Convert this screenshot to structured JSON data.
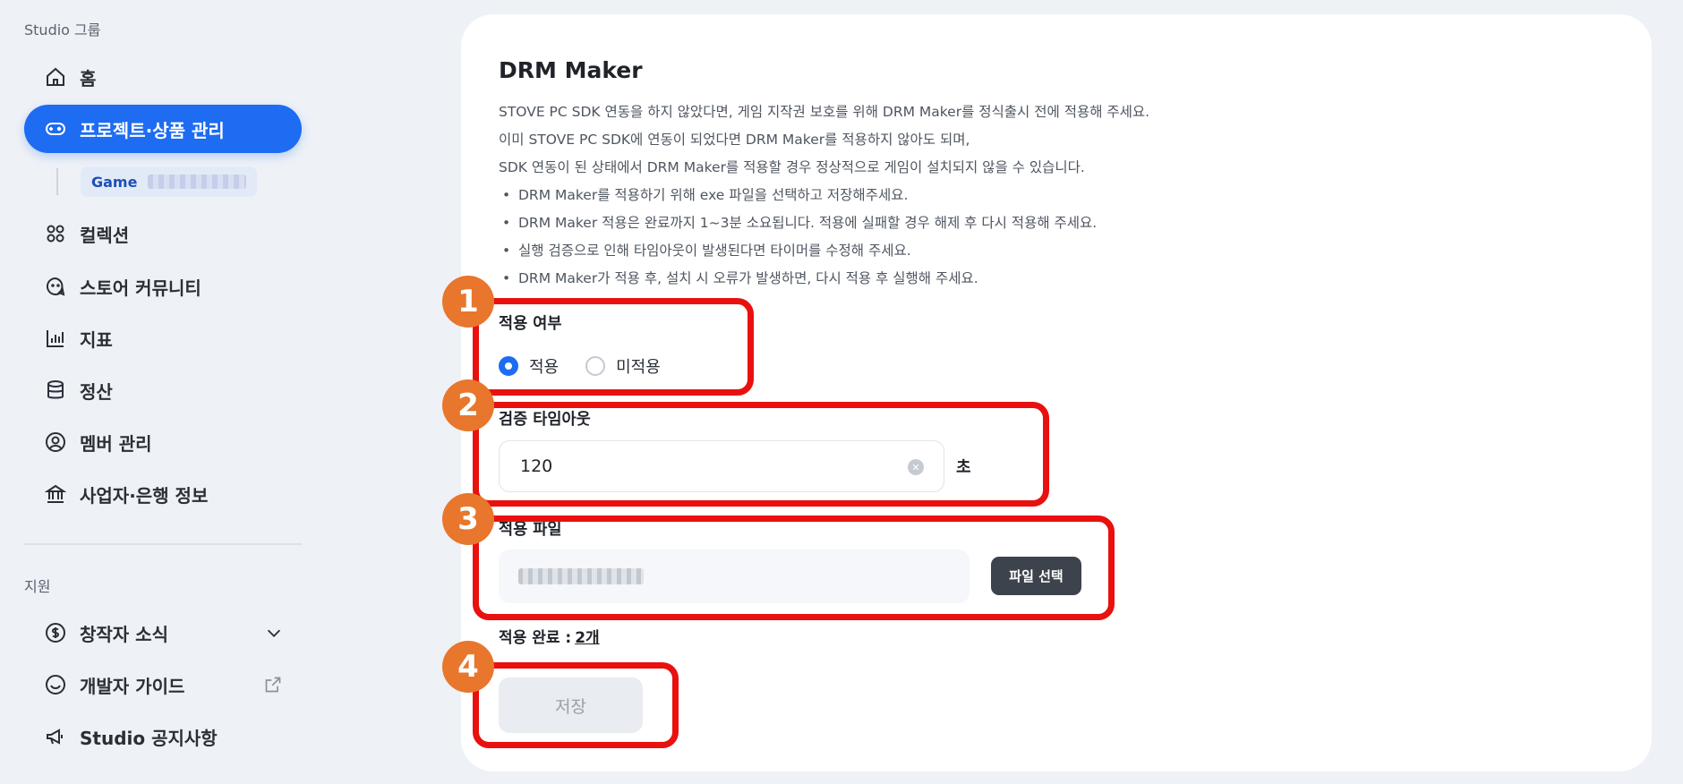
{
  "sidebar": {
    "group_label": "Studio 그룹",
    "items": [
      {
        "label": "홈",
        "icon": "home-icon"
      },
      {
        "label": "프로젝트·상품 관리",
        "icon": "gamepad-icon",
        "active": true
      },
      {
        "label": "컬렉션",
        "icon": "collection-icon"
      },
      {
        "label": "스토어 커뮤니티",
        "icon": "chat-icon"
      },
      {
        "label": "지표",
        "icon": "chart-icon"
      },
      {
        "label": "정산",
        "icon": "database-icon"
      },
      {
        "label": "멤버 관리",
        "icon": "user-icon"
      },
      {
        "label": "사업자·은행 정보",
        "icon": "bank-icon"
      }
    ],
    "sub_item": {
      "label": "Game"
    },
    "support_label": "지원",
    "support_items": [
      {
        "label": "창작자 소식",
        "icon": "dollar-icon"
      },
      {
        "label": "개발자 가이드",
        "icon": "smile-icon"
      },
      {
        "label": "Studio 공지사항",
        "icon": "megaphone-icon"
      }
    ]
  },
  "main": {
    "title": "DRM Maker",
    "desc_lines": [
      "STOVE PC SDK 연동을 하지 않았다면, 게임 지작권 보호를 위해 DRM Maker를 정식출시 전에 적용해 주세요.",
      "이미 STOVE PC SDK에 연동이 되었다면 DRM Maker를 적용하지 않아도 되며,",
      "SDK 연동이 된 상태에서 DRM Maker를 적용할 경우 정상적으로 게임이 설치되지 않을 수 있습니다."
    ],
    "bullets": [
      "DRM Maker를 적용하기 위해 exe 파일을 선택하고 저장해주세요.",
      "DRM Maker 적용은 완료까지 1~3분 소요됩니다. 적용에 실패할 경우 해제 후 다시 적용해 주세요.",
      "실행 검증으로 인해 타임아웃이 발생된다면 타이머를 수정해 주세요.",
      "DRM Maker가 적용 후, 설치 시 오류가 발생하면, 다시 적용 후 실행해 주세요."
    ],
    "apply_label": "적용 여부",
    "radio_apply": "적용",
    "radio_not_apply": "미적용",
    "timeout_label": "검증 타임아웃",
    "timeout_value": "120",
    "timeout_unit": "초",
    "file_label": "적용 파일",
    "file_button": "파일 선택",
    "done_label": "적용 완료 :",
    "done_count": "2개",
    "save_label": "저장"
  },
  "annotations": {
    "badge_1": "1",
    "badge_2": "2",
    "badge_3": "3",
    "badge_4": "4",
    "highlight_color": "#e8110f",
    "badge_color": "#e8762c"
  },
  "colors": {
    "accent": "#1d6cf2"
  }
}
